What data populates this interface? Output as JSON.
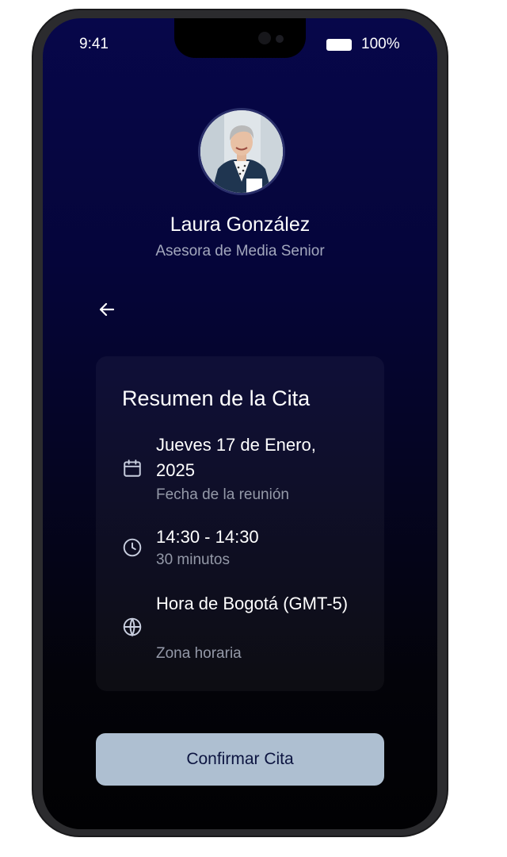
{
  "status_bar": {
    "time": "9:41",
    "battery": "100%"
  },
  "profile": {
    "name": "Laura González",
    "role": "Asesora de Media Senior"
  },
  "summary": {
    "title": "Resumen de la Cita",
    "date": {
      "icon": "calendar-icon",
      "value": "Jueves 17 de Enero, 2025",
      "label": "Fecha de la reunión"
    },
    "time": {
      "icon": "clock-icon",
      "value": "14:30 - 14:30",
      "label": "30 minutos"
    },
    "timezone": {
      "icon": "globe-icon",
      "value": "Hora de Bogotá (GMT-5)",
      "label": "Zona horaria"
    }
  },
  "actions": {
    "back_icon": "arrow-left-icon",
    "confirm_label": "Confirmar Cita"
  },
  "colors": {
    "background_top": "#07074a",
    "background_bottom": "#010103",
    "card": "#121223",
    "button": "#aebfd1",
    "button_text": "#0c1440"
  }
}
